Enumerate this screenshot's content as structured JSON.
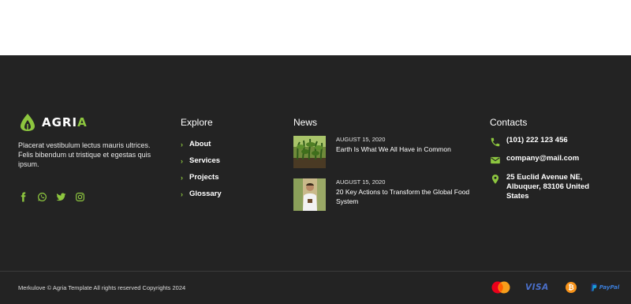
{
  "brand": {
    "logo_text_main": "AGRI",
    "logo_text_accent": "A",
    "description": "Placerat vestibulum lectus mauris ultrices. Felis bibendum ut tristique et egestas quis ipsum."
  },
  "socials": [
    "facebook-icon",
    "whatsapp-icon",
    "twitter-icon",
    "instagram-icon"
  ],
  "explore": {
    "title": "Explore",
    "links": [
      "About",
      "Services",
      "Projects",
      "Glossary"
    ]
  },
  "news": {
    "title": "News",
    "items": [
      {
        "date": "AUGUST 15, 2020",
        "headline": "Earth Is What We All Have in Common"
      },
      {
        "date": "AUGUST 15, 2020",
        "headline": "20 Key Actions to Transform the Global Food System"
      }
    ]
  },
  "contacts": {
    "title": "Contacts",
    "phone": "(101) 222 123 456",
    "email": "company@mail.com",
    "address": "25 Euclid Avenue NE, Albuquer, 83106 United States"
  },
  "footer": {
    "copyright": "Merkulove © Agria Template All rights reserved Copyrights 2024",
    "payments": [
      "Mastercard",
      "VISA",
      "Bitcoin",
      "PayPal"
    ]
  },
  "colors": {
    "accent": "#8dc63f",
    "background": "#232323"
  }
}
